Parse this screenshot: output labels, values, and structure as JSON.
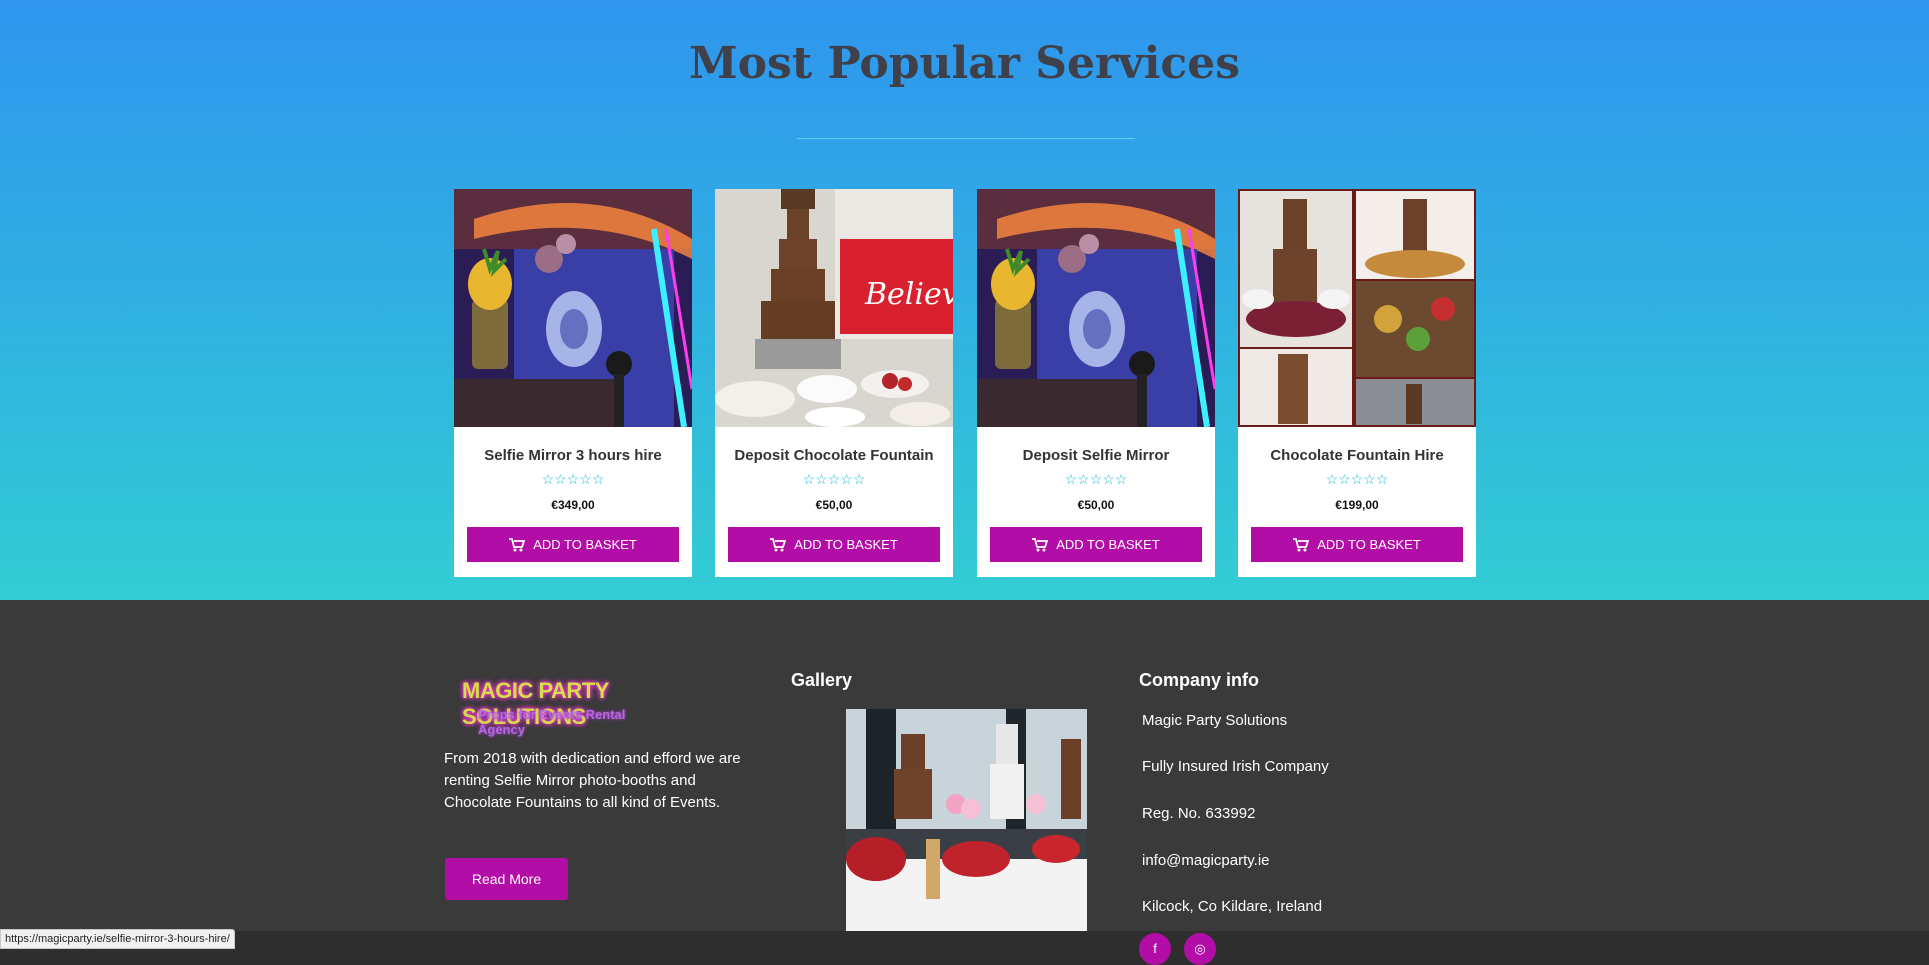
{
  "section": {
    "title": "Most Popular Services"
  },
  "products": [
    {
      "name": "Selfie Mirror 3 hours hire",
      "stars": "☆☆☆☆☆",
      "rating": 0,
      "price": "€349,00",
      "button": "ADD TO BASKET"
    },
    {
      "name": "Deposit Chocolate Fountain",
      "stars": "☆☆☆☆☆",
      "rating": 0,
      "price": "€50,00",
      "button": "ADD TO BASKET"
    },
    {
      "name": "Deposit Selfie Mirror",
      "stars": "☆☆☆☆☆",
      "rating": 0,
      "price": "€50,00",
      "button": "ADD TO BASKET"
    },
    {
      "name": "Chocolate Fountain Hire",
      "stars": "☆☆☆☆☆",
      "rating": 0,
      "price": "€199,00",
      "button": "ADD TO BASKET"
    }
  ],
  "footer": {
    "logo_line1": "MAGIC PARTY SOLUTIONS",
    "logo_line2": "Props for Events Rental Agency",
    "about": "From 2018 with dedication and efford we are renting Selfie Mirror photo-booths and Chocolate Fountains to all kind of Events.",
    "read_more": "Read More",
    "gallery_title": "Gallery",
    "company_title": "Company info",
    "company_lines": [
      "Magic Party Solutions",
      "Fully Insured Irish Company",
      "Reg. No. 633992",
      "info@magicparty.ie",
      "Kilcock, Co Kildare, Ireland"
    ],
    "social": [
      {
        "icon": "facebook-icon",
        "glyph": "f"
      },
      {
        "icon": "instagram-icon",
        "glyph": "◎"
      }
    ]
  },
  "status_url": "https://magicparty.ie/selfie-mirror-3-hours-hire/",
  "colors": {
    "accent": "#b30da8",
    "star": "#22b8d8",
    "footer_bg": "#3a3a3a"
  }
}
